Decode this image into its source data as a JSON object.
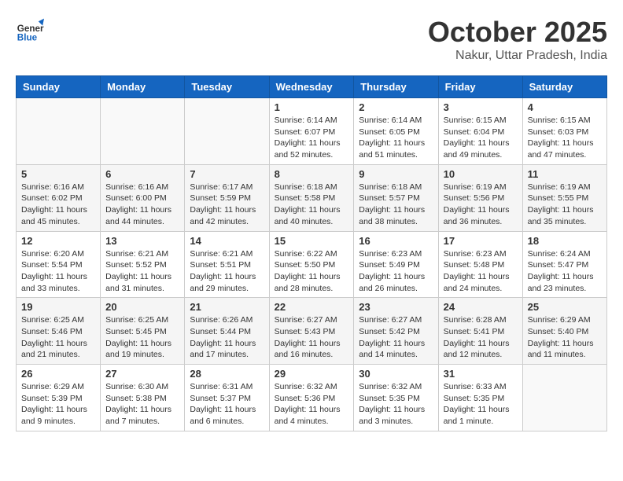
{
  "header": {
    "logo_general": "General",
    "logo_blue": "Blue",
    "month": "October 2025",
    "location": "Nakur, Uttar Pradesh, India"
  },
  "weekdays": [
    "Sunday",
    "Monday",
    "Tuesday",
    "Wednesday",
    "Thursday",
    "Friday",
    "Saturday"
  ],
  "weeks": [
    [
      {
        "day": "",
        "content": ""
      },
      {
        "day": "",
        "content": ""
      },
      {
        "day": "",
        "content": ""
      },
      {
        "day": "1",
        "content": "Sunrise: 6:14 AM\nSunset: 6:07 PM\nDaylight: 11 hours\nand 52 minutes."
      },
      {
        "day": "2",
        "content": "Sunrise: 6:14 AM\nSunset: 6:05 PM\nDaylight: 11 hours\nand 51 minutes."
      },
      {
        "day": "3",
        "content": "Sunrise: 6:15 AM\nSunset: 6:04 PM\nDaylight: 11 hours\nand 49 minutes."
      },
      {
        "day": "4",
        "content": "Sunrise: 6:15 AM\nSunset: 6:03 PM\nDaylight: 11 hours\nand 47 minutes."
      }
    ],
    [
      {
        "day": "5",
        "content": "Sunrise: 6:16 AM\nSunset: 6:02 PM\nDaylight: 11 hours\nand 45 minutes."
      },
      {
        "day": "6",
        "content": "Sunrise: 6:16 AM\nSunset: 6:00 PM\nDaylight: 11 hours\nand 44 minutes."
      },
      {
        "day": "7",
        "content": "Sunrise: 6:17 AM\nSunset: 5:59 PM\nDaylight: 11 hours\nand 42 minutes."
      },
      {
        "day": "8",
        "content": "Sunrise: 6:18 AM\nSunset: 5:58 PM\nDaylight: 11 hours\nand 40 minutes."
      },
      {
        "day": "9",
        "content": "Sunrise: 6:18 AM\nSunset: 5:57 PM\nDaylight: 11 hours\nand 38 minutes."
      },
      {
        "day": "10",
        "content": "Sunrise: 6:19 AM\nSunset: 5:56 PM\nDaylight: 11 hours\nand 36 minutes."
      },
      {
        "day": "11",
        "content": "Sunrise: 6:19 AM\nSunset: 5:55 PM\nDaylight: 11 hours\nand 35 minutes."
      }
    ],
    [
      {
        "day": "12",
        "content": "Sunrise: 6:20 AM\nSunset: 5:54 PM\nDaylight: 11 hours\nand 33 minutes."
      },
      {
        "day": "13",
        "content": "Sunrise: 6:21 AM\nSunset: 5:52 PM\nDaylight: 11 hours\nand 31 minutes."
      },
      {
        "day": "14",
        "content": "Sunrise: 6:21 AM\nSunset: 5:51 PM\nDaylight: 11 hours\nand 29 minutes."
      },
      {
        "day": "15",
        "content": "Sunrise: 6:22 AM\nSunset: 5:50 PM\nDaylight: 11 hours\nand 28 minutes."
      },
      {
        "day": "16",
        "content": "Sunrise: 6:23 AM\nSunset: 5:49 PM\nDaylight: 11 hours\nand 26 minutes."
      },
      {
        "day": "17",
        "content": "Sunrise: 6:23 AM\nSunset: 5:48 PM\nDaylight: 11 hours\nand 24 minutes."
      },
      {
        "day": "18",
        "content": "Sunrise: 6:24 AM\nSunset: 5:47 PM\nDaylight: 11 hours\nand 23 minutes."
      }
    ],
    [
      {
        "day": "19",
        "content": "Sunrise: 6:25 AM\nSunset: 5:46 PM\nDaylight: 11 hours\nand 21 minutes."
      },
      {
        "day": "20",
        "content": "Sunrise: 6:25 AM\nSunset: 5:45 PM\nDaylight: 11 hours\nand 19 minutes."
      },
      {
        "day": "21",
        "content": "Sunrise: 6:26 AM\nSunset: 5:44 PM\nDaylight: 11 hours\nand 17 minutes."
      },
      {
        "day": "22",
        "content": "Sunrise: 6:27 AM\nSunset: 5:43 PM\nDaylight: 11 hours\nand 16 minutes."
      },
      {
        "day": "23",
        "content": "Sunrise: 6:27 AM\nSunset: 5:42 PM\nDaylight: 11 hours\nand 14 minutes."
      },
      {
        "day": "24",
        "content": "Sunrise: 6:28 AM\nSunset: 5:41 PM\nDaylight: 11 hours\nand 12 minutes."
      },
      {
        "day": "25",
        "content": "Sunrise: 6:29 AM\nSunset: 5:40 PM\nDaylight: 11 hours\nand 11 minutes."
      }
    ],
    [
      {
        "day": "26",
        "content": "Sunrise: 6:29 AM\nSunset: 5:39 PM\nDaylight: 11 hours\nand 9 minutes."
      },
      {
        "day": "27",
        "content": "Sunrise: 6:30 AM\nSunset: 5:38 PM\nDaylight: 11 hours\nand 7 minutes."
      },
      {
        "day": "28",
        "content": "Sunrise: 6:31 AM\nSunset: 5:37 PM\nDaylight: 11 hours\nand 6 minutes."
      },
      {
        "day": "29",
        "content": "Sunrise: 6:32 AM\nSunset: 5:36 PM\nDaylight: 11 hours\nand 4 minutes."
      },
      {
        "day": "30",
        "content": "Sunrise: 6:32 AM\nSunset: 5:35 PM\nDaylight: 11 hours\nand 3 minutes."
      },
      {
        "day": "31",
        "content": "Sunrise: 6:33 AM\nSunset: 5:35 PM\nDaylight: 11 hours\nand 1 minute."
      },
      {
        "day": "",
        "content": ""
      }
    ]
  ]
}
